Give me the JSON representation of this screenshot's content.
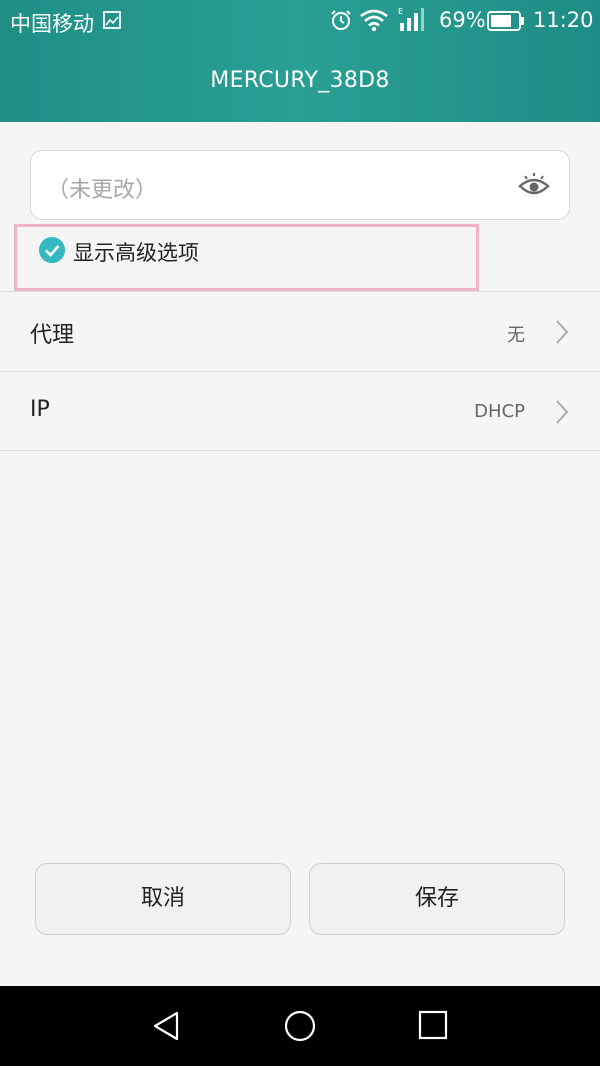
{
  "status_bar": {
    "carrier": "中国移动",
    "battery_percent": "69%",
    "time": "11:20",
    "icons": [
      "image-icon",
      "alarm-icon",
      "wifi-icon",
      "signal-icon",
      "battery-icon"
    ]
  },
  "header": {
    "title": "MERCURY_38D8"
  },
  "password": {
    "placeholder": "（未更改）"
  },
  "advanced": {
    "label": "显示高级选项",
    "checked": true
  },
  "settings": {
    "proxy": {
      "label": "代理",
      "value": "无"
    },
    "ip": {
      "label": "IP",
      "value": "DHCP"
    }
  },
  "buttons": {
    "cancel": "取消",
    "save": "保存"
  },
  "nav": {
    "icons": [
      "back-icon",
      "home-icon",
      "recent-apps-icon"
    ]
  },
  "colors": {
    "header": "#1f8f86",
    "accent_check": "#36b8c2",
    "highlight_border": "#f1b3c8"
  }
}
